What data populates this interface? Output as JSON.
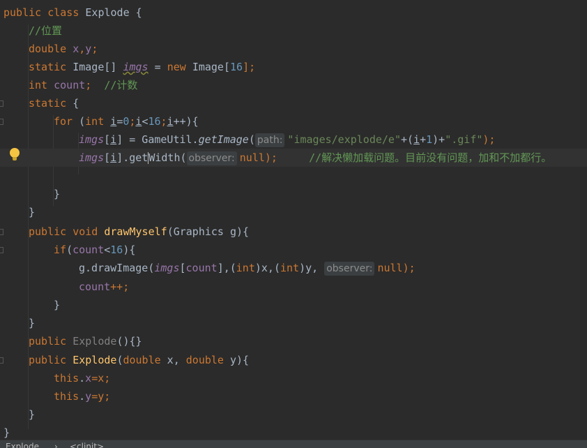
{
  "editor": {
    "lines": {
      "l1_public": "public",
      "l1_class": "class",
      "l1_name": "Explode",
      "l1_brace": "{",
      "l2_comment": "//位置",
      "l3_type": "double",
      "l3_x": "x",
      "l3_comma": ",",
      "l3_y": "y",
      "l3_semi": ";",
      "l4_static": "static",
      "l4_type": "Image[]",
      "l4_imgs": "imgs",
      "l4_eq": "=",
      "l4_new": "new",
      "l4_image": "Image[",
      "l4_num": "16",
      "l4_end": "];",
      "l5_int": "int",
      "l5_count": "count",
      "l5_semi": ";",
      "l5_comment": "//计数",
      "l6_static": "static",
      "l6_brace": "{",
      "l7_for": "for",
      "l7_paren": "(",
      "l7_int": "int",
      "l7_i1": "i",
      "l7_eq0": "=",
      "l7_zero": "0",
      "l7_semi1": ";",
      "l7_i2": "i",
      "l7_lt": "<",
      "l7_16": "16",
      "l7_semi2": ";",
      "l7_i3": "i",
      "l7_inc": "++){",
      "l8_imgs": "imgs",
      "l8_br1": "[",
      "l8_i": "i",
      "l8_br2": "] = GameUtil.",
      "l8_method": "getImage",
      "l8_paren": "(",
      "l8_hint": "path:",
      "l8_str1": "\"images/explode/e\"",
      "l8_plus": "+(",
      "l8_i2": "i",
      "l8_plus1": "+",
      "l8_one": "1",
      "l8_close": ")+",
      "l8_str2": "\".gif\"",
      "l8_end": ");",
      "l9_imgs": "imgs",
      "l9_br1": "[",
      "l9_i": "i",
      "l9_br2": "].",
      "l9_get_a": "get",
      "l9_get_b": "Width(",
      "l9_hint": "observer:",
      "l9_null": "null",
      "l9_end": ");",
      "l9_comment": "//解决懒加载问题。目前没有问题，加和不加都行。",
      "l11_brace": "}",
      "l12_brace": "}",
      "l13_public": "public",
      "l13_void": "void",
      "l13_method": "drawMyself",
      "l13_params": "(Graphics g){",
      "l14_if": "if",
      "l14_p": "(",
      "l14_count": "count",
      "l14_lt": "<",
      "l14_16": "16",
      "l14_end": "){",
      "l15_g": "g.drawImage(",
      "l15_imgs": "imgs",
      "l15_br": "[",
      "l15_count": "count",
      "l15_br2": "],(",
      "l15_int1": "int",
      "l15_x": ")x,(",
      "l15_int2": "int",
      "l15_y": ")y,",
      "l15_hint": "observer:",
      "l15_null": "null",
      "l15_end": ");",
      "l16_count": "count",
      "l16_end": "++;",
      "l17_brace": "}",
      "l18_brace": "}",
      "l19_public": "public",
      "l19_ctor": "Explode",
      "l19_end": "(){}",
      "l20_public": "public",
      "l20_ctor": "Explode",
      "l20_p": "(",
      "l20_double1": "double",
      "l20_x": " x, ",
      "l20_double2": "double",
      "l20_y": " y){",
      "l21_this": "this",
      "l21_dot": ".",
      "l21_x": "x",
      "l21_rest": "=x;",
      "l22_this": "this",
      "l22_dot": ".",
      "l22_y": "y",
      "l22_rest": "=y;",
      "l23_brace": "}",
      "l24_brace": "}"
    }
  },
  "status_bar": {
    "item1": "Explode",
    "sep": "›",
    "item2": "<clinit>"
  },
  "icons": {
    "intention": "lightbulb-icon"
  },
  "colors": {
    "background": "#2b2b2b",
    "keyword": "#cc7832",
    "field": "#9876aa",
    "number": "#6897bb",
    "string": "#6a8759",
    "comment": "#629755",
    "method_decl": "#ffc66d",
    "default_text": "#a9b7c6"
  }
}
